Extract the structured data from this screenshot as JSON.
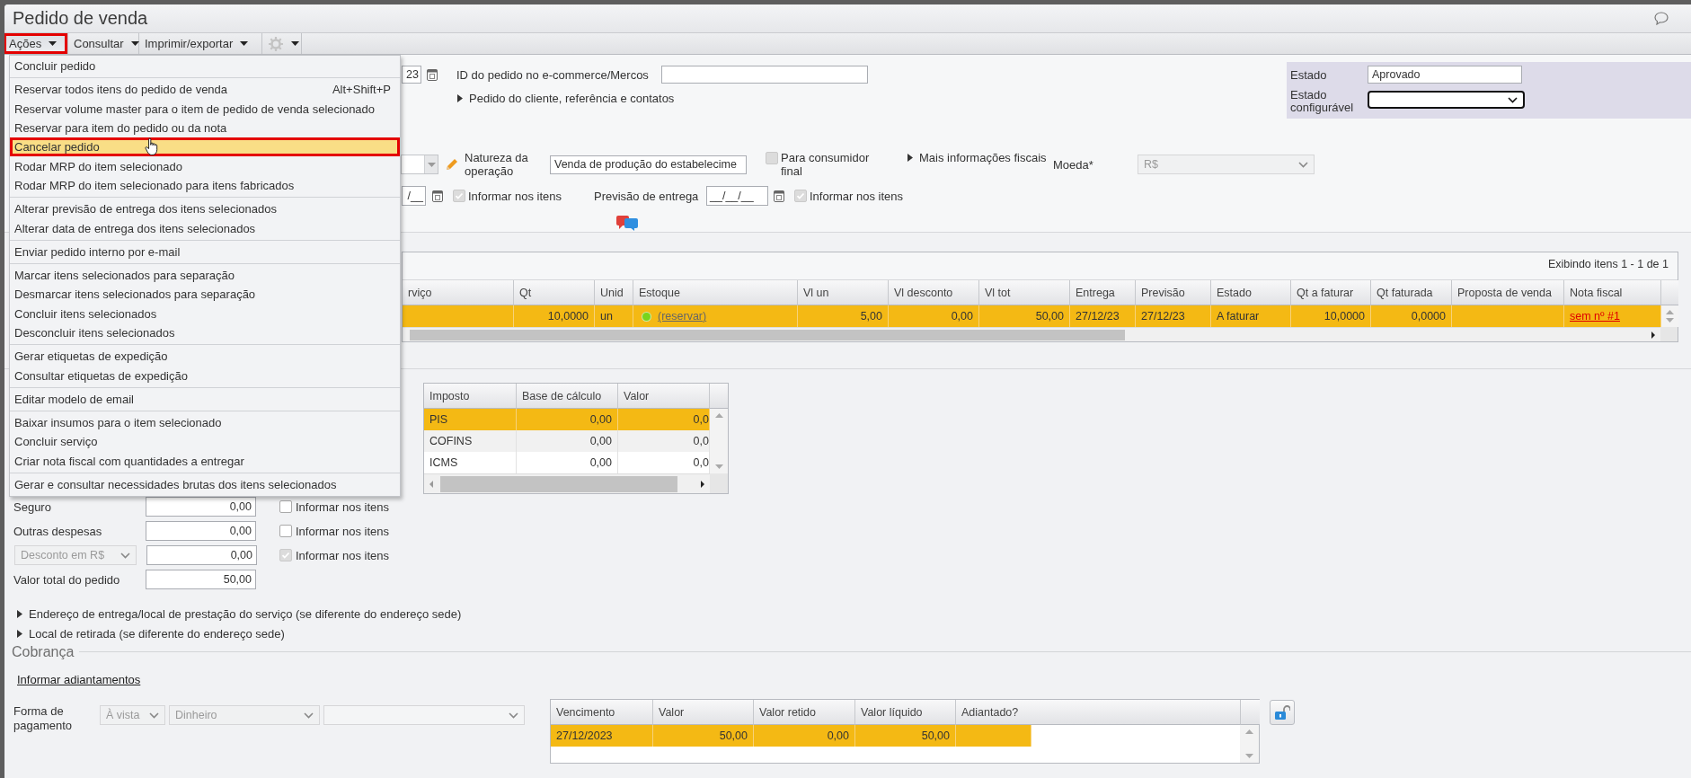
{
  "window": {
    "title": "Pedido de venda"
  },
  "toolbar": [
    {
      "kind": "menu",
      "label": "Ações",
      "expanded": true,
      "annotated": true
    },
    {
      "kind": "menu",
      "label": "Consultar",
      "expanded": false,
      "annotated": false
    },
    {
      "kind": "menu",
      "label": "Imprimir/exportar",
      "expanded": false,
      "annotated": false
    },
    {
      "kind": "settings",
      "expanded": false,
      "annotated": false
    }
  ],
  "actions_menu": [
    [
      {
        "label": "Concluir pedido",
        "selected": false,
        "annotated": false
      }
    ],
    [
      {
        "label": "Reservar todos itens do pedido de venda",
        "shortcut": "Alt+Shift+P",
        "selected": false,
        "annotated": false
      },
      {
        "label": "Reservar volume master para o item de pedido de venda selecionado",
        "selected": false,
        "annotated": false
      },
      {
        "label": "Reservar para item do pedido ou da nota",
        "selected": false,
        "annotated": false
      },
      {
        "label": "Cancelar pedido",
        "selected": true,
        "annotated": true
      },
      {
        "label": "Rodar MRP do item selecionado",
        "selected": false,
        "annotated": false
      },
      {
        "label": "Rodar MRP do item selecionado para itens fabricados",
        "selected": false,
        "annotated": false
      }
    ],
    [
      {
        "label": "Alterar previsão de entrega dos itens selecionados",
        "selected": false,
        "annotated": false
      },
      {
        "label": "Alterar data de entrega dos itens selecionados",
        "selected": false,
        "annotated": false
      }
    ],
    [
      {
        "label": "Enviar pedido interno por e-mail",
        "selected": false,
        "annotated": false
      }
    ],
    [
      {
        "label": "Marcar itens selecionados para separação",
        "selected": false,
        "annotated": false
      },
      {
        "label": "Desmarcar itens selecionados para separação",
        "selected": false,
        "annotated": false
      },
      {
        "label": "Concluir itens selecionados",
        "selected": false,
        "annotated": false
      },
      {
        "label": "Desconcluir itens selecionados",
        "selected": false,
        "annotated": false
      }
    ],
    [
      {
        "label": "Gerar etiquetas de expedição",
        "selected": false,
        "annotated": false
      },
      {
        "label": "Consultar etiquetas de expedição",
        "selected": false,
        "annotated": false
      }
    ],
    [
      {
        "label": "Editar modelo de email",
        "selected": false,
        "annotated": false
      }
    ],
    [
      {
        "label": "Baixar insumos para o item selecionado",
        "selected": false,
        "annotated": false
      },
      {
        "label": "Concluir serviço",
        "selected": false,
        "annotated": false
      },
      {
        "label": "Criar nota fiscal com quantidades a entregar",
        "selected": false,
        "annotated": false
      }
    ],
    [
      {
        "label": "Gerar e consultar necessidades brutas dos itens selecionados",
        "selected": false,
        "annotated": false
      }
    ]
  ],
  "order": {
    "date_fragment": "23",
    "ecommerce_id_label": "ID do pedido no e-commerce/Mercos",
    "customer_section": {
      "label": "Pedido do cliente, referência e contatos",
      "expanded": false
    },
    "status": {
      "label": "Estado",
      "value": "Aprovado"
    },
    "custom_status": {
      "label": "Estado configurável"
    }
  },
  "fiscal": {
    "operation_label": "Natureza da operação",
    "operation_value": "Venda de produção do estabelecime",
    "final_consumer": {
      "label": "Para consumidor final",
      "checked": false,
      "disabled": true
    },
    "more_fiscal": {
      "label": "Mais informações fiscais",
      "expanded": false
    },
    "currency": {
      "label": "Moeda*",
      "value": "R$"
    }
  },
  "delivery": {
    "date_fragment": "/__",
    "inform_items": {
      "label": "Informar nos itens",
      "checked": true,
      "disabled": true
    },
    "forecast": {
      "label": "Previsão de entrega",
      "value": "__/__/__"
    },
    "forecast_inform": {
      "label": "Informar nos itens",
      "checked": true,
      "disabled": true
    }
  },
  "items_grid": {
    "info": "Exibindo itens 1 - 1 de 1",
    "columns": [
      "rviço",
      "Qt",
      "Unid",
      "Estoque",
      "Vl un",
      "Vl desconto",
      "Vl tot",
      "Entrega",
      "Previsão",
      "Estado",
      "Qt a faturar",
      "Qt faturada",
      "Proposta de venda",
      "Nota fiscal"
    ],
    "rows": [
      {
        "selected": true,
        "qt": "10,0000",
        "unit": "un",
        "stock": {
          "label": "(reservar)",
          "color": "#79d41c"
        },
        "unit_price": "5,00",
        "discount": "0,00",
        "total": "50,00",
        "delivery": "27/12/23",
        "forecast": "27/12/23",
        "status": "A faturar",
        "to_invoice": "10,0000",
        "invoiced": "0,0000",
        "invoice": "sem nº #1"
      }
    ]
  },
  "taxes": {
    "columns": [
      "Imposto",
      "Base de cálculo",
      "Valor"
    ],
    "rows": [
      {
        "tax": "PIS",
        "base": "0,00",
        "value": "0,0",
        "selected": true
      },
      {
        "tax": "COFINS",
        "base": "0,00",
        "value": "0,0",
        "selected": false
      },
      {
        "tax": "ICMS",
        "base": "0,00",
        "value": "0,0",
        "selected": false
      }
    ]
  },
  "totals": [
    {
      "kind": "field",
      "label": "Seguro",
      "value": "0,00",
      "inform": {
        "label": "Informar nos itens",
        "checked": false,
        "disabled": false
      }
    },
    {
      "kind": "field",
      "label": "Outras despesas",
      "value": "0,00",
      "inform": {
        "label": "Informar nos itens",
        "checked": false,
        "disabled": false
      }
    },
    {
      "kind": "discount",
      "label": "Desconto em R$",
      "value": "0,00",
      "inform": {
        "label": "Informar nos itens",
        "checked": true,
        "disabled": true
      }
    },
    {
      "kind": "total",
      "label": "Valor total do pedido",
      "value": "50,00"
    }
  ],
  "sections": [
    {
      "label": "Endereço de entrega/local de prestação do serviço (se diferente do endereço sede)",
      "expanded": false
    },
    {
      "label": "Local de retirada (se diferente do endereço sede)",
      "expanded": false
    }
  ],
  "billing": {
    "title": "Cobrança",
    "advance_link": "Informar adiantamentos",
    "payment_label": "Forma de pagamento",
    "payment_term": "À vista",
    "payment_method": "Dinheiro",
    "installments": {
      "columns": [
        "Vencimento",
        "Valor",
        "Valor retido",
        "Valor líquido",
        "Adiantado?"
      ],
      "rows": [
        {
          "due": "27/12/2023",
          "value": "50,00",
          "withheld": "0,00",
          "net": "50,00",
          "selected": true
        }
      ]
    }
  }
}
